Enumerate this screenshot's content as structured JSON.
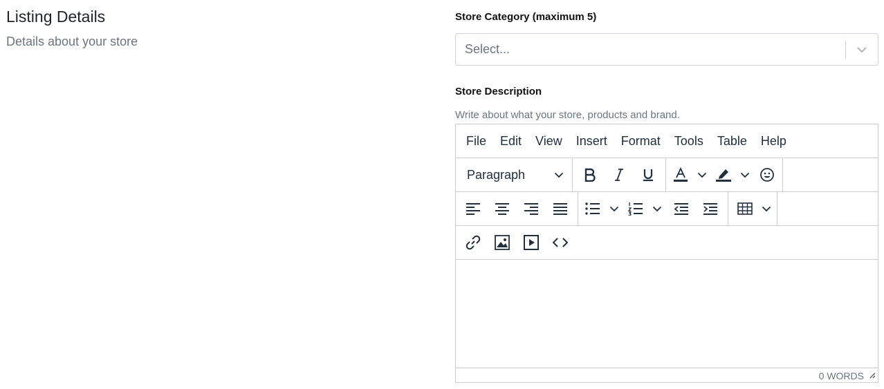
{
  "section": {
    "title": "Listing Details",
    "subtitle": "Details about your store"
  },
  "category": {
    "label": "Store Category (maximum 5)",
    "placeholder": "Select..."
  },
  "description": {
    "label": "Store Description",
    "help": "Write about what your store, products and brand."
  },
  "editor": {
    "menu": [
      "File",
      "Edit",
      "View",
      "Insert",
      "Format",
      "Tools",
      "Table",
      "Help"
    ],
    "block_format": "Paragraph",
    "word_count": "0 WORDS",
    "icons": [
      "bold-icon",
      "italic-icon",
      "underline-icon",
      "text-color-icon",
      "highlight-icon",
      "emoticons-icon",
      "align-left-icon",
      "align-center-icon",
      "align-right-icon",
      "justify-icon",
      "bullet-list-icon",
      "numbered-list-icon",
      "outdent-icon",
      "indent-icon",
      "table-icon",
      "link-icon",
      "image-icon",
      "media-icon",
      "source-code-icon"
    ],
    "text_color": "#222f3e"
  }
}
